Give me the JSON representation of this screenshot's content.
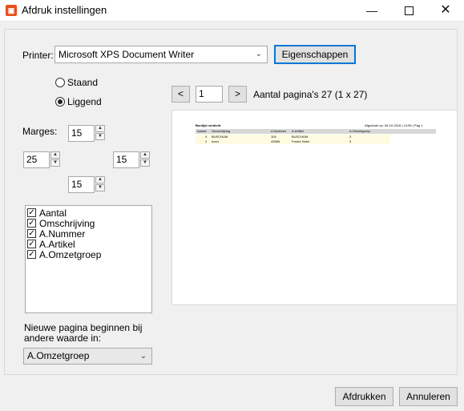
{
  "window": {
    "title": "Afdruk instellingen",
    "app_icon": "app-logo-icon",
    "minimize_icon": "minimize-icon",
    "maximize_icon": "maximize-icon",
    "close_icon": "close-icon"
  },
  "printer": {
    "label": "Printer:",
    "selected": "Microsoft XPS Document Writer",
    "properties_button": "Eigenschappen"
  },
  "orientation": {
    "options": [
      "Staand",
      "Liggend"
    ],
    "selected": "Liggend"
  },
  "margins": {
    "label": "Marges:",
    "top": "15",
    "left": "25",
    "right": "15",
    "bottom": "15"
  },
  "fields": [
    {
      "label": "Aantal",
      "checked": true
    },
    {
      "label": "Omschrijving",
      "checked": true
    },
    {
      "label": "A.Nummer",
      "checked": true
    },
    {
      "label": "A.Artikel",
      "checked": true
    },
    {
      "label": "A.Omzetgroep",
      "checked": true
    }
  ],
  "new_page": {
    "label_line1": "Nieuwe pagina beginnen bij",
    "label_line2": "andere waarde in:",
    "selected": "A.Omzetgroep"
  },
  "pager": {
    "prev": "<",
    "next": ">",
    "page": "1",
    "count_text": "Aantal pagina's 27 (1 x 27)"
  },
  "preview": {
    "title": "Bonlijst verdicht",
    "header_right": "Afgedrukt op: 06-10-2016 | 14:55 | Pag 1",
    "columns": [
      "Aantal",
      "Omschrijving",
      "A.Nummer",
      "A.Artikel",
      "A.Omzetgroep"
    ],
    "rows": [
      [
        "4",
        "BUSCHUM",
        "104",
        "BUSCHUM",
        "3"
      ],
      [
        "2",
        "doen",
        "43965",
        "Freerk Halm",
        "3"
      ]
    ]
  },
  "footer": {
    "print_button": "Afdrukken",
    "cancel_button": "Annuleren"
  },
  "colors": {
    "accent": "#0078d7",
    "app_icon": "#e94e1b",
    "preview_row_highlight": "#fffbe0"
  }
}
